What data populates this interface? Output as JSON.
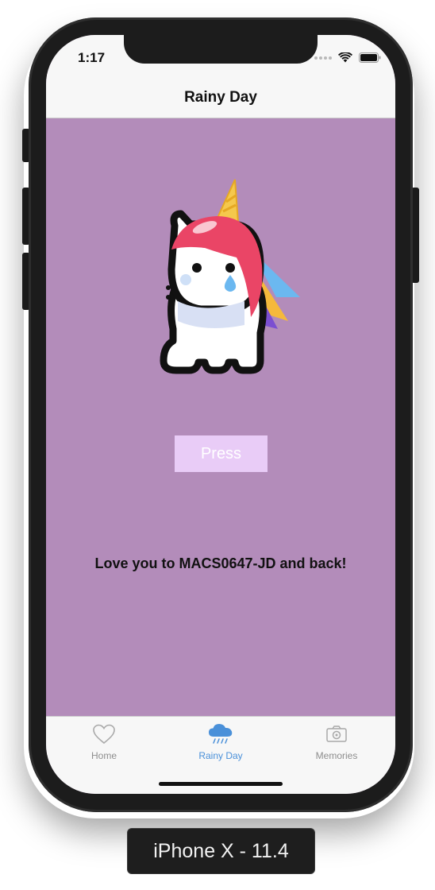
{
  "status_bar": {
    "time": "1:17"
  },
  "nav": {
    "title": "Rainy Day"
  },
  "main": {
    "press_label": "Press",
    "message": "Love you to MACS0647-JD and back!",
    "image_icon": "crying-unicorn-icon"
  },
  "tabs": [
    {
      "label": "Home",
      "icon": "heart-icon",
      "selected": false
    },
    {
      "label": "Rainy Day",
      "icon": "rain-cloud-icon",
      "selected": true
    },
    {
      "label": "Memories",
      "icon": "camera-icon",
      "selected": false
    }
  ],
  "device_label": "iPhone X - 11.4",
  "colors": {
    "background": "#b38cba",
    "button": "#e9ccf7",
    "tab_active": "#4a90d9",
    "tab_inactive": "#8e8e8e"
  }
}
